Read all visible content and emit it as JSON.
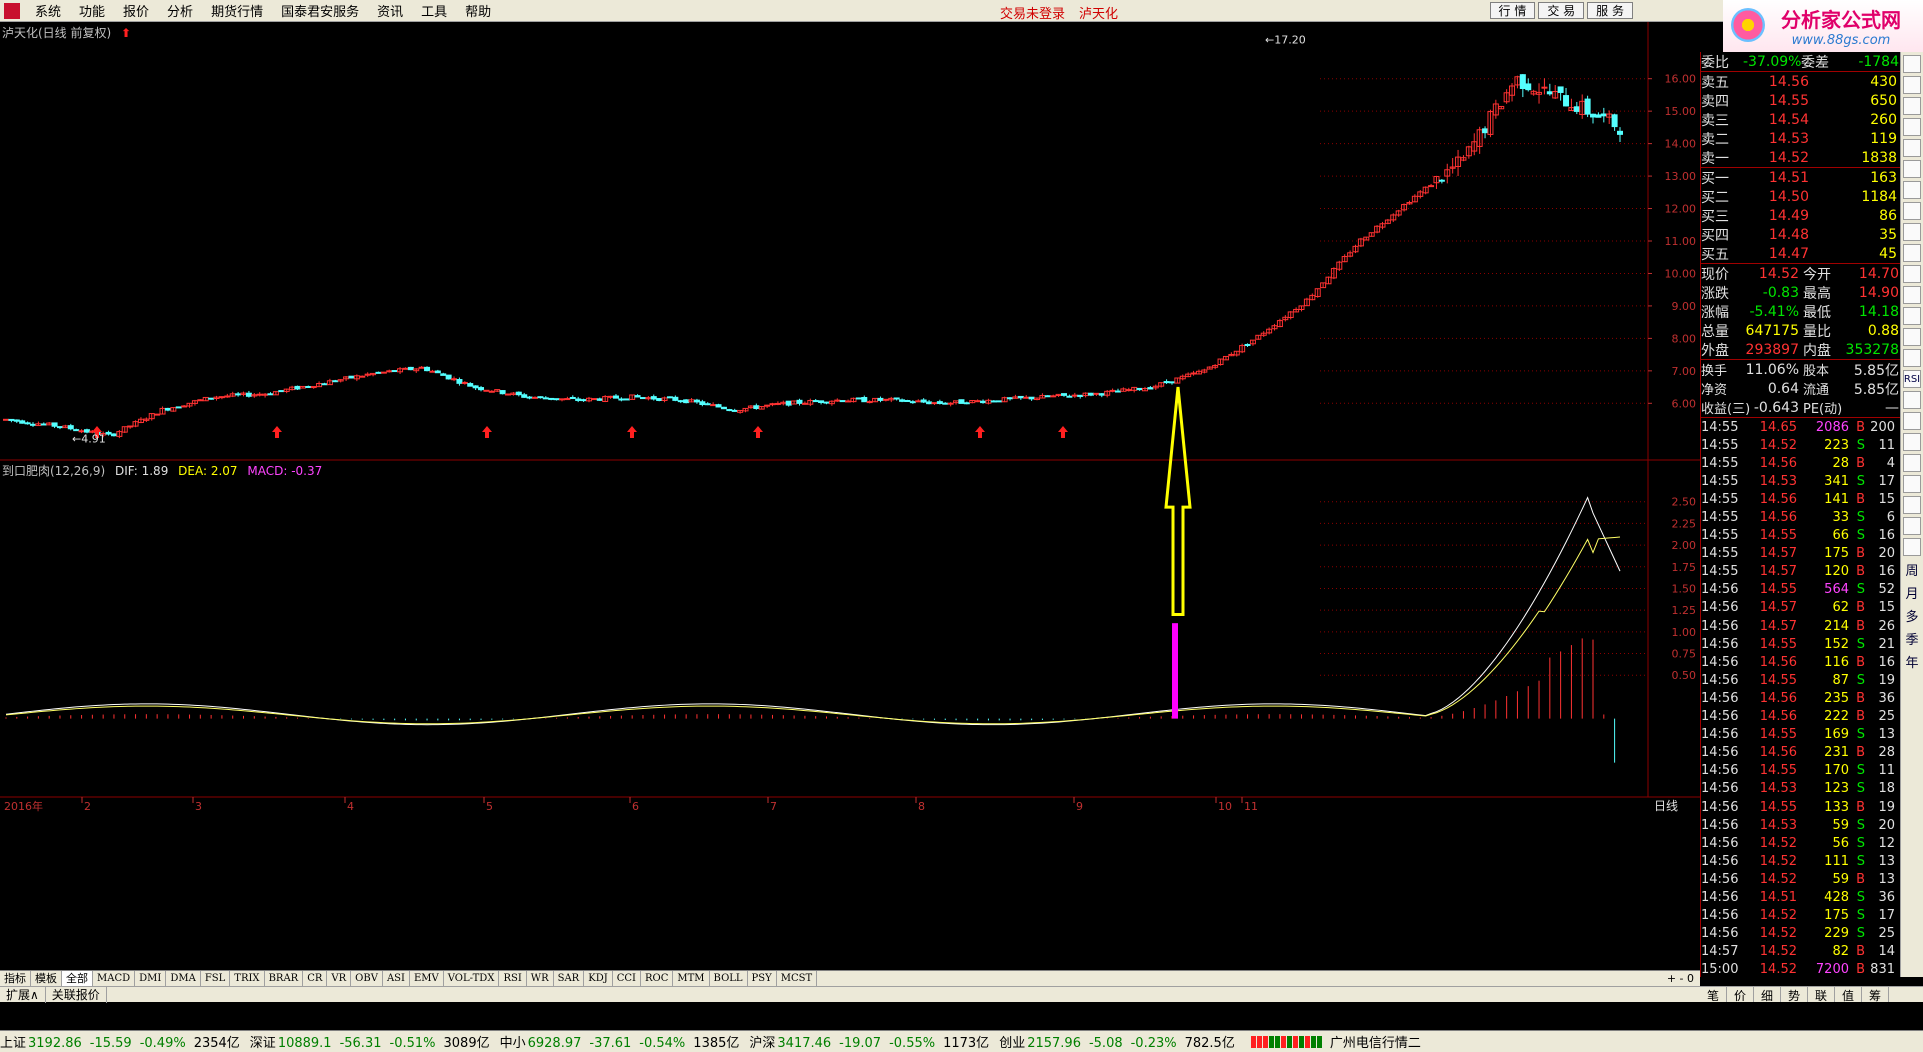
{
  "menu": {
    "items": [
      "系统",
      "功能",
      "报价",
      "分析",
      "期货行情",
      "国泰君安服务",
      "资讯",
      "工具",
      "帮助"
    ],
    "login_status": "交易未登录",
    "current_stock": "泸天化",
    "btn_quote": "行 情",
    "btn_trade": "交 易",
    "btn_service": "服 务"
  },
  "brand": {
    "title": "分析家公式网",
    "url": "www.88gs.com"
  },
  "chart": {
    "main_title": "泸天化(日线 前复权)",
    "macd_title": "到口肥肉(12,26,9)",
    "dif": "DIF: 1.89",
    "dea": "DEA: 2.07",
    "macd": "MACD: -0.37",
    "max_label": "17.20",
    "min_label": "4.91",
    "period": "日线",
    "year_label": "2016年",
    "month_labels": [
      "2",
      "3",
      "4",
      "5",
      "6",
      "7",
      "8",
      "9",
      "10",
      "11"
    ],
    "price_axis": [
      "16.00",
      "15.00",
      "14.00",
      "13.00",
      "12.00",
      "11.00",
      "10.00",
      "9.00",
      "8.00",
      "7.00",
      "6.00"
    ],
    "macd_axis": [
      "2.50",
      "2.25",
      "2.00",
      "1.75",
      "1.50",
      "1.25",
      "1.00",
      "0.75",
      "0.50"
    ],
    "colors": {
      "up": "#ff3232",
      "down": "#54ffff",
      "grid": "#8b0000",
      "dif_line": "#ffffff",
      "dea_line": "#ffff66",
      "signal_bar": "#ff00ff",
      "arrow": "#ffff00"
    }
  },
  "chart_data": {
    "type": "candlestick",
    "x_range": [
      "2016-01",
      "2016-11"
    ],
    "ylim": [
      4.5,
      17.5
    ],
    "close_approx": [
      5.5,
      5.3,
      5.0,
      5.8,
      6.2,
      6.3,
      6.6,
      6.9,
      7.1,
      6.5,
      6.2,
      6.1,
      6.2,
      6.1,
      5.8,
      6.0,
      6.1,
      6.1,
      6.0,
      6.1,
      6.2,
      6.3,
      6.5,
      7.0,
      8.0,
      9.2,
      11.0,
      12.3,
      13.5,
      16.0,
      15.3,
      14.52
    ],
    "macd_ylim": [
      -0.5,
      2.75
    ],
    "dif_final": 1.89,
    "dea_final": 2.07,
    "macd_final": -0.37
  },
  "quote": {
    "weibi_label": "委比",
    "weibi_val": "-37.09%",
    "weicha_label": "委差",
    "weicha_val": "-1784",
    "sell": [
      {
        "label": "卖五",
        "price": "14.56",
        "vol": "430"
      },
      {
        "label": "卖四",
        "price": "14.55",
        "vol": "650"
      },
      {
        "label": "卖三",
        "price": "14.54",
        "vol": "260"
      },
      {
        "label": "卖二",
        "price": "14.53",
        "vol": "119"
      },
      {
        "label": "卖一",
        "price": "14.52",
        "vol": "1838"
      }
    ],
    "buy": [
      {
        "label": "买一",
        "price": "14.51",
        "vol": "163"
      },
      {
        "label": "买二",
        "price": "14.50",
        "vol": "1184"
      },
      {
        "label": "买三",
        "price": "14.49",
        "vol": "86"
      },
      {
        "label": "买四",
        "price": "14.48",
        "vol": "35"
      },
      {
        "label": "买五",
        "price": "14.47",
        "vol": "45"
      }
    ],
    "stats": [
      {
        "l1": "现价",
        "v1": "14.52",
        "c1": "c-red",
        "l2": "今开",
        "v2": "14.70",
        "c2": "c-red"
      },
      {
        "l1": "涨跌",
        "v1": "-0.83",
        "c1": "c-grn",
        "l2": "最高",
        "v2": "14.90",
        "c2": "c-red"
      },
      {
        "l1": "涨幅",
        "v1": "-5.41%",
        "c1": "c-grn",
        "l2": "最低",
        "v2": "14.18",
        "c2": "c-grn"
      },
      {
        "l1": "总量",
        "v1": "647175",
        "c1": "c-yel",
        "l2": "量比",
        "v2": "0.88",
        "c2": "c-yel"
      },
      {
        "l1": "外盘",
        "v1": "293897",
        "c1": "c-red",
        "l2": "内盘",
        "v2": "353278",
        "c2": "c-grn"
      }
    ],
    "stats2": [
      {
        "l1": "换手",
        "v1": "11.06%",
        "l2": "股本",
        "v2": "5.85亿"
      },
      {
        "l1": "净资",
        "v1": "0.64",
        "l2": "流通",
        "v2": "5.85亿"
      },
      {
        "l1": "收益(三)",
        "v1": "-0.643",
        "l2": "PE(动)",
        "v2": "—"
      }
    ],
    "ticks": [
      [
        "14:55",
        "14.65",
        "2086",
        "B",
        "200"
      ],
      [
        "14:55",
        "14.52",
        "223",
        "S",
        "11"
      ],
      [
        "14:55",
        "14.56",
        "28",
        "B",
        "4"
      ],
      [
        "14:55",
        "14.53",
        "341",
        "S",
        "17"
      ],
      [
        "14:55",
        "14.56",
        "141",
        "B",
        "15"
      ],
      [
        "14:55",
        "14.56",
        "33",
        "S",
        "6"
      ],
      [
        "14:55",
        "14.55",
        "66",
        "S",
        "16"
      ],
      [
        "14:55",
        "14.57",
        "175",
        "B",
        "20"
      ],
      [
        "14:55",
        "14.57",
        "120",
        "B",
        "16"
      ],
      [
        "14:56",
        "14.55",
        "564",
        "S",
        "52"
      ],
      [
        "14:56",
        "14.57",
        "62",
        "B",
        "15"
      ],
      [
        "14:56",
        "14.57",
        "214",
        "B",
        "26"
      ],
      [
        "14:56",
        "14.55",
        "152",
        "S",
        "21"
      ],
      [
        "14:56",
        "14.56",
        "116",
        "B",
        "16"
      ],
      [
        "14:56",
        "14.55",
        "87",
        "S",
        "19"
      ],
      [
        "14:56",
        "14.56",
        "235",
        "B",
        "36"
      ],
      [
        "14:56",
        "14.56",
        "222",
        "B",
        "25"
      ],
      [
        "14:56",
        "14.55",
        "169",
        "S",
        "13"
      ],
      [
        "14:56",
        "14.56",
        "231",
        "B",
        "28"
      ],
      [
        "14:56",
        "14.55",
        "170",
        "S",
        "11"
      ],
      [
        "14:56",
        "14.53",
        "123",
        "S",
        "18"
      ],
      [
        "14:56",
        "14.55",
        "133",
        "B",
        "19"
      ],
      [
        "14:56",
        "14.53",
        "59",
        "S",
        "20"
      ],
      [
        "14:56",
        "14.52",
        "56",
        "S",
        "12"
      ],
      [
        "14:56",
        "14.52",
        "111",
        "S",
        "13"
      ],
      [
        "14:56",
        "14.52",
        "59",
        "B",
        "13"
      ],
      [
        "14:56",
        "14.51",
        "428",
        "S",
        "36"
      ],
      [
        "14:56",
        "14.52",
        "175",
        "S",
        "17"
      ],
      [
        "14:56",
        "14.52",
        "229",
        "S",
        "25"
      ],
      [
        "14:57",
        "14.52",
        "82",
        "B",
        "14"
      ],
      [
        "15:00",
        "14.52",
        "7200",
        "B",
        "831"
      ]
    ]
  },
  "tabs": {
    "row1": [
      "指标",
      "模板",
      "全部",
      "MACD",
      "DMI",
      "DMA",
      "FSL",
      "TRIX",
      "BRAR",
      "CR",
      "VR",
      "OBV",
      "ASI",
      "EMV",
      "VOL-TDX",
      "RSI",
      "WR",
      "SAR",
      "KDJ",
      "CCI",
      "ROC",
      "MTM",
      "BOLL",
      "PSY",
      "MCST"
    ],
    "row2": [
      "扩展∧",
      "关联报价"
    ],
    "quote_tabs": [
      "笔",
      "价",
      "细",
      "势",
      "联",
      "值",
      "筹"
    ]
  },
  "rtools": [
    "周",
    "月",
    "多",
    "季",
    "年"
  ],
  "status": {
    "indices": [
      {
        "name": "上证",
        "val": "3192.86",
        "chg": "-15.59",
        "pct": "-0.49%",
        "vol": "2354亿"
      },
      {
        "name": "深证",
        "val": "10889.1",
        "chg": "-56.31",
        "pct": "-0.51%",
        "vol": "3089亿"
      },
      {
        "name": "中小",
        "val": "6928.97",
        "chg": "-37.61",
        "pct": "-0.54%",
        "vol": "1385亿"
      },
      {
        "name": "沪深",
        "val": "3417.46",
        "chg": "-19.07",
        "pct": "-0.55%",
        "vol": "1173亿"
      },
      {
        "name": "创业",
        "val": "2157.96",
        "chg": "-5.08",
        "pct": "-0.23%",
        "vol": "782.5亿"
      }
    ],
    "server": "广州电信行情二"
  }
}
